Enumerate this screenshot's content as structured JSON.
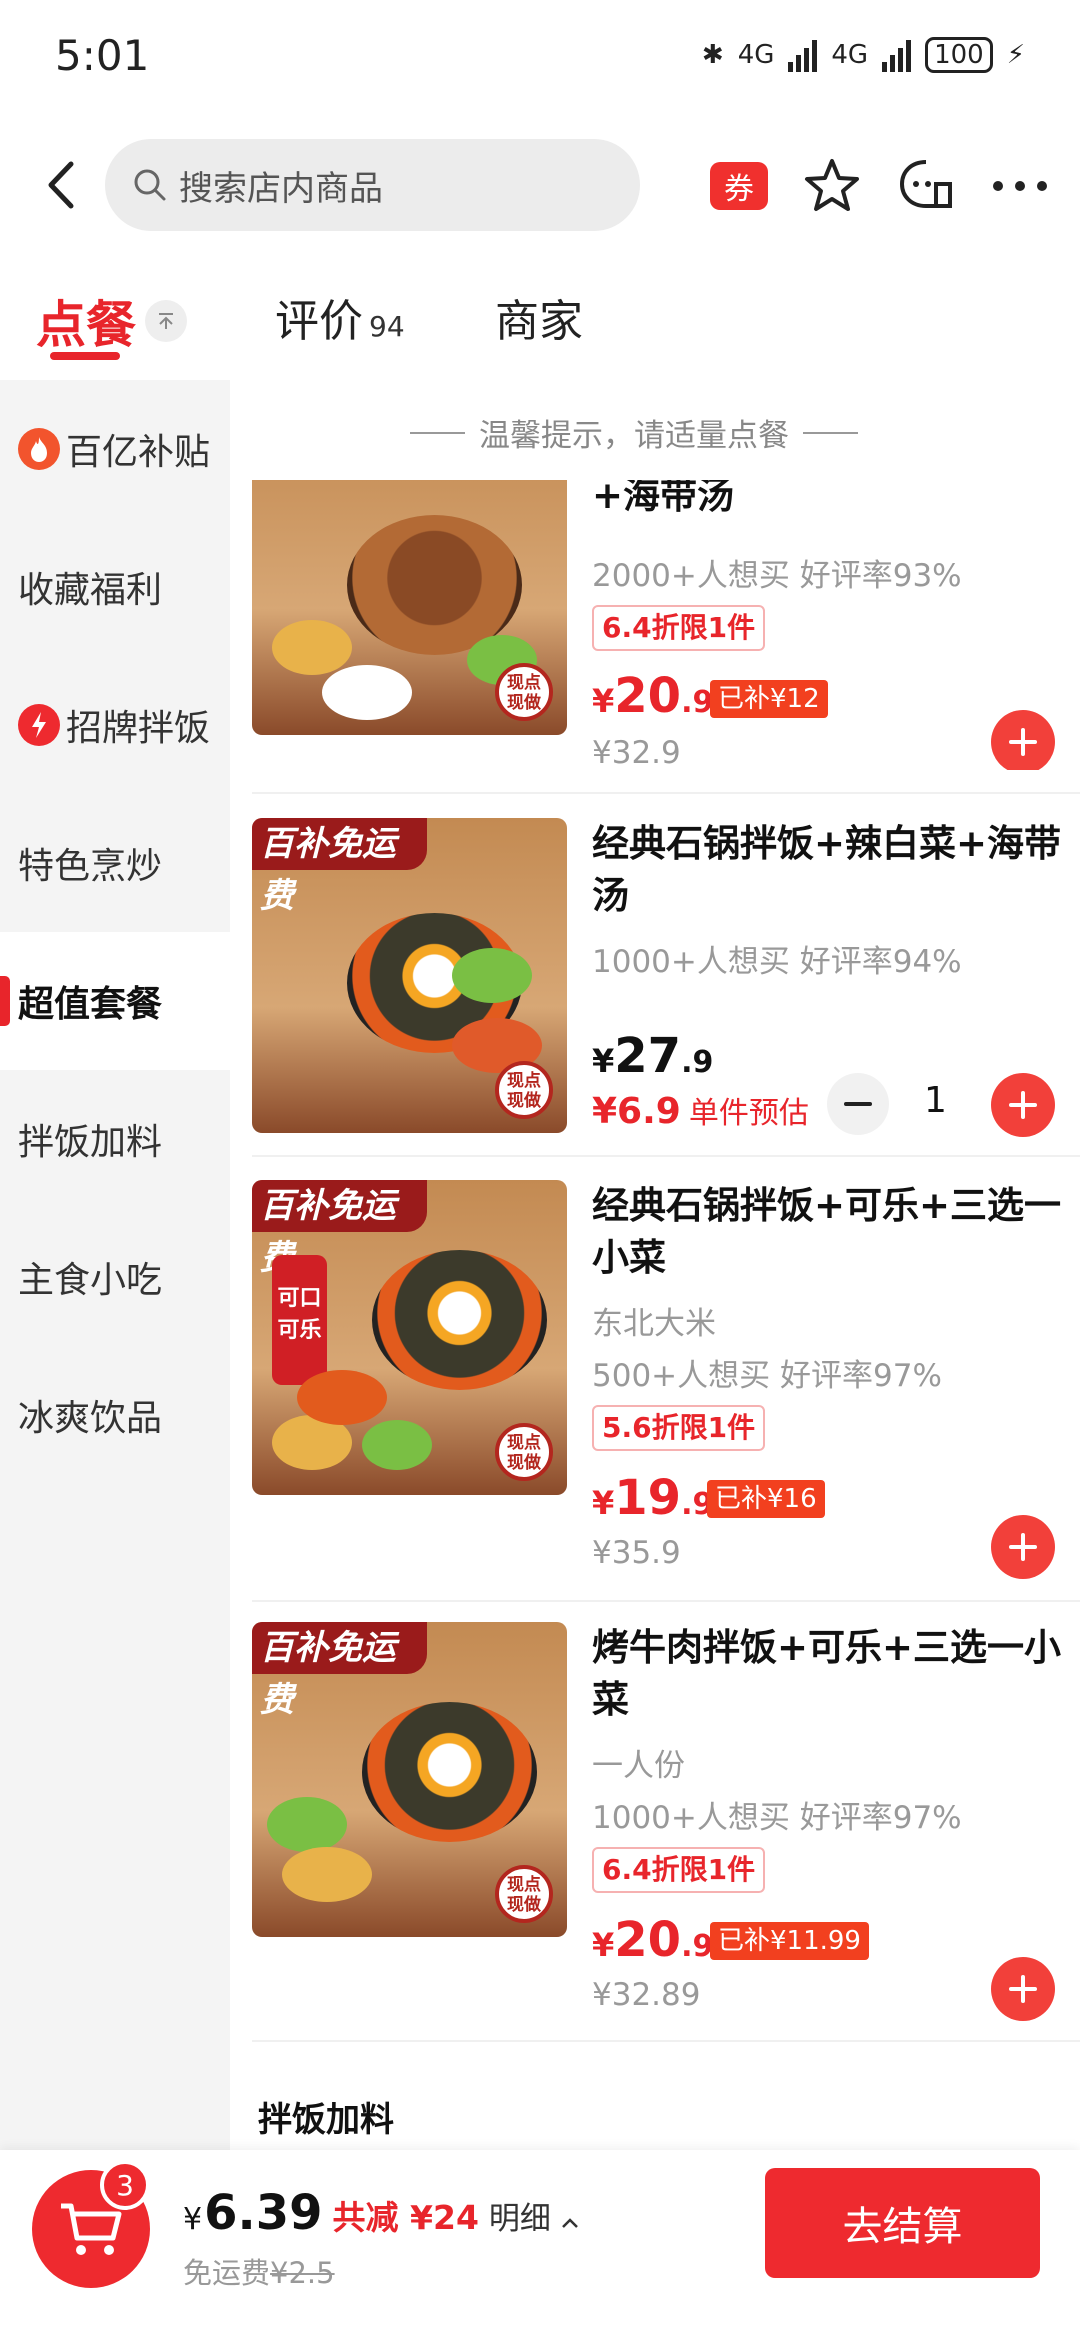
{
  "status_bar": {
    "time": "5:01",
    "network1": "4G",
    "network2": "4G",
    "battery": "100"
  },
  "header": {
    "search_placeholder": "搜索店内商品",
    "coupon_label": "券"
  },
  "tabs": [
    {
      "label": "点餐"
    },
    {
      "label": "评价",
      "count": "94"
    },
    {
      "label": "商家"
    }
  ],
  "sidebar": {
    "items": [
      {
        "label": "百亿补贴"
      },
      {
        "label": "收藏福利"
      },
      {
        "label": "招牌拌饭"
      },
      {
        "label": "特色烹炒"
      },
      {
        "label": "超值套餐"
      },
      {
        "label": "拌饭加料"
      },
      {
        "label": "主食小吃"
      },
      {
        "label": "冰爽饮品"
      }
    ]
  },
  "tip": "温馨提示，请适量点餐",
  "products": [
    {
      "title": "+海带汤",
      "sales": "2000+人想买 好评率93%",
      "discount": "6.4折限1件",
      "price_cur": "¥",
      "price_int": "20",
      "price_dec": ".9",
      "subsidy": "已补¥12",
      "orig": "¥32.9",
      "seal": "现点现做"
    },
    {
      "title": "经典石锅拌饭+辣白菜+海带汤",
      "sales": "1000+人想买 好评率94%",
      "banner": "百补免运费",
      "price_cur": "¥",
      "price_int": "27",
      "price_dec": ".9",
      "est_value": "¥6.9",
      "est_label": "单件预估",
      "qty": "1",
      "seal": "现点现做"
    },
    {
      "title": "经典石锅拌饭+可乐+三选一小菜",
      "desc": "东北大米",
      "sales": "500+人想买 好评率97%",
      "banner": "百补免运费",
      "can_label": "可口可乐",
      "discount": "5.6折限1件",
      "price_cur": "¥",
      "price_int": "19",
      "price_dec": ".9",
      "subsidy": "已补¥16",
      "orig": "¥35.9",
      "seal": "现点现做"
    },
    {
      "title": "烤牛肉拌饭+可乐+三选一小菜",
      "desc": "一人份",
      "sales": "1000+人想买 好评率97%",
      "banner": "百补免运费",
      "discount": "6.4折限1件",
      "price_cur": "¥",
      "price_int": "20",
      "price_dec": ".9",
      "subsidy": "已补¥11.99",
      "orig": "¥32.89",
      "seal": "现点现做"
    }
  ],
  "section_title": "拌饭加料",
  "cart": {
    "badge": "3",
    "total_cur": "¥",
    "total_value": "6.39",
    "cut": "共减 ¥24",
    "detail": "明细",
    "free_ship": "免运费",
    "ship_orig": "¥2.5",
    "checkout": "去结算"
  }
}
